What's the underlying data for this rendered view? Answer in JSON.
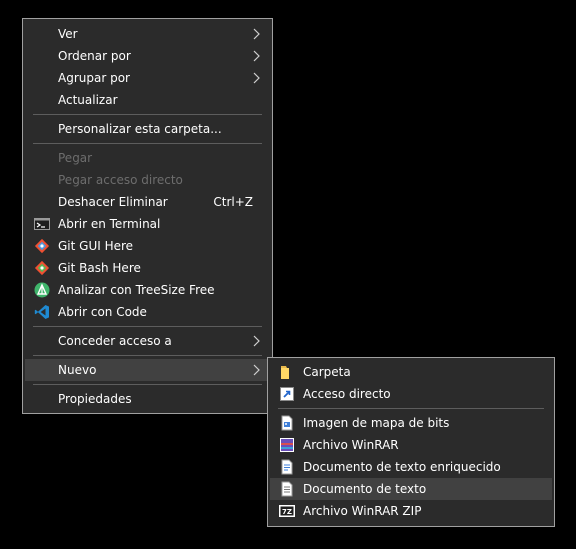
{
  "main_menu": {
    "ver": "Ver",
    "ordenar_por": "Ordenar por",
    "agrupar_por": "Agrupar por",
    "actualizar": "Actualizar",
    "personalizar": "Personalizar esta carpeta...",
    "pegar": "Pegar",
    "pegar_acceso_directo": "Pegar acceso directo",
    "deshacer": "Deshacer Eliminar",
    "deshacer_shortcut": "Ctrl+Z",
    "abrir_terminal": "Abrir en Terminal",
    "git_gui": "Git GUI Here",
    "git_bash": "Git Bash Here",
    "treesize": "Analizar con TreeSize Free",
    "abrir_code": "Abrir con Code",
    "conceder_acceso": "Conceder acceso a",
    "nuevo": "Nuevo",
    "propiedades": "Propiedades"
  },
  "sub_menu": {
    "carpeta": "Carpeta",
    "acceso_directo": "Acceso directo",
    "imagen_bits": "Imagen de mapa de bits",
    "archivo_winrar": "Archivo WinRAR",
    "texto_enriquecido": "Documento de texto enriquecido",
    "documento_texto": "Documento de texto",
    "winrar_zip": "Archivo WinRAR ZIP"
  },
  "icons": {
    "terminal": "terminal-icon",
    "git_gui": "git-icon",
    "git_bash": "git-icon",
    "treesize": "treesize-icon",
    "code": "vscode-icon",
    "carpeta": "folder-icon",
    "acceso_directo": "shortcut-icon",
    "imagen": "bitmap-icon",
    "winrar": "winrar-icon",
    "rtf": "rich-text-document-icon",
    "txt": "text-document-icon",
    "winrar_zip": "winrar-zip-icon"
  },
  "colors": {
    "menu_background": "#2b2b2b",
    "menu_border": "#a0a0a0",
    "highlight": "#414141",
    "disabled_text": "#6d6d6d"
  }
}
